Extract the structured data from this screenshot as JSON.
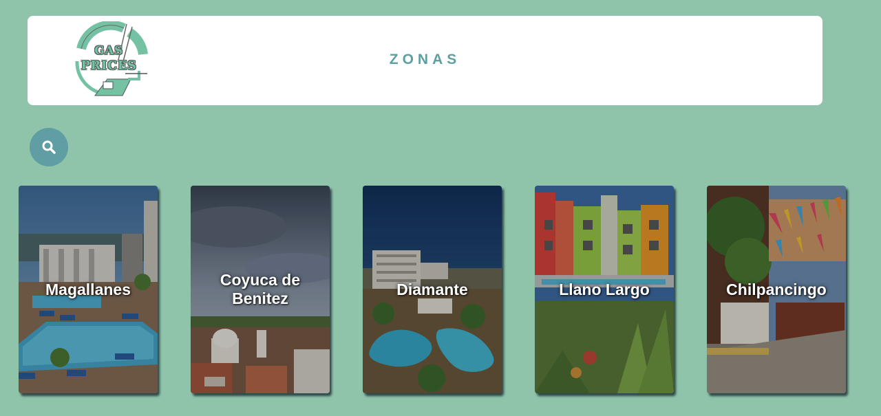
{
  "header": {
    "logo": {
      "line1": "GAS",
      "line2": "PRICES"
    },
    "title": "ZONAS"
  },
  "search": {
    "icon": "search-icon"
  },
  "zones": [
    {
      "name": "Magallanes"
    },
    {
      "name": "Coyuca de Benitez"
    },
    {
      "name": "Diamante"
    },
    {
      "name": "Llano Largo"
    },
    {
      "name": "Chilpancingo"
    }
  ],
  "colors": {
    "background": "#8fc4aa",
    "accent": "#5f9fa4",
    "logo_green": "#74c2a3"
  }
}
